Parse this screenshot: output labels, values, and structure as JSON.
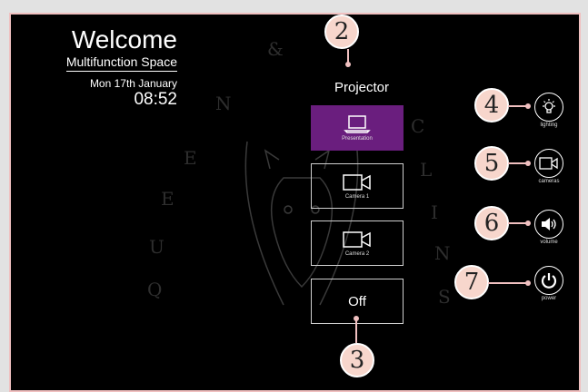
{
  "header": {
    "title": "Welcome",
    "room": "Multifunction Space",
    "date": "Mon 17th January",
    "time": "08:52"
  },
  "projector": {
    "label": "Projector",
    "sources": [
      {
        "label": "Presentation",
        "icon": "laptop-icon",
        "active": true
      },
      {
        "label": "Camera 1",
        "icon": "camera-icon",
        "active": false
      },
      {
        "label": "Camera 2",
        "icon": "camera-icon",
        "active": false
      }
    ],
    "off_label": "Off"
  },
  "controls": [
    {
      "label": "lighting",
      "icon": "lightbulb-icon"
    },
    {
      "label": "cameras",
      "icon": "camera-icon"
    },
    {
      "label": "volume",
      "icon": "speaker-icon"
    },
    {
      "label": "power",
      "icon": "power-icon"
    }
  ],
  "callouts": [
    "2",
    "3",
    "4",
    "5",
    "6",
    "7"
  ],
  "colors": {
    "active_source": "#6a1e7e",
    "callout_fill": "#f7d6cc",
    "frame_border": "#f0c0c0"
  }
}
